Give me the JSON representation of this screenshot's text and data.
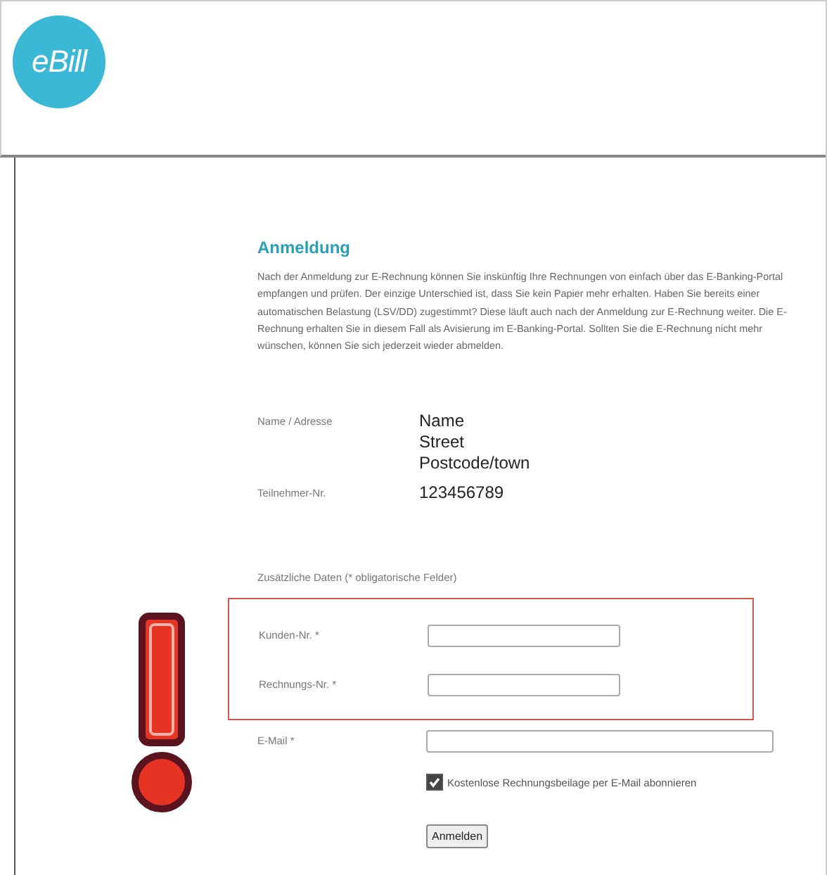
{
  "logo": "eBill",
  "heading": "Anmeldung",
  "paragraph": "Nach der Anmeldung zur E-Rechnung können Sie inskünftig Ihre Rechnungen von einfach über das E-Banking-Portal empfangen und prüfen. Der einzige Unterschied ist, dass Sie kein Papier mehr erhalten. Haben Sie bereits einer automatischen Belastung (LSV/DD) zugestimmt? Diese läuft auch nach der Anmeldung zur E-Rechnung weiter. Die E-Rechnung erhalten Sie in diesem Fall als Avisierung im E-Banking-Portal. Sollten Sie die E-Rechnung nicht mehr wünschen, können Sie sich jederzeit wieder abmelden.",
  "info": [
    {
      "label": "Name / Adresse",
      "lines": [
        "Name",
        "Street",
        "Postcode/town"
      ]
    },
    {
      "label": "Teilnehmer-Nr.",
      "lines": [
        "123456789"
      ]
    }
  ],
  "section_note": "Zusätzliche Daten (* obligatorische Felder)",
  "highlighted_fields": [
    {
      "label": "Kunden-Nr. *",
      "wide": false
    },
    {
      "label": "Rechnungs-Nr. *",
      "wide": false
    }
  ],
  "fields": [
    {
      "label": "E-Mail *",
      "wide": true
    }
  ],
  "checkbox": {
    "label": "Kostenlose Rechnungsbeilage per E-Mail abonnieren",
    "checked": true
  },
  "button": "Anmelden"
}
